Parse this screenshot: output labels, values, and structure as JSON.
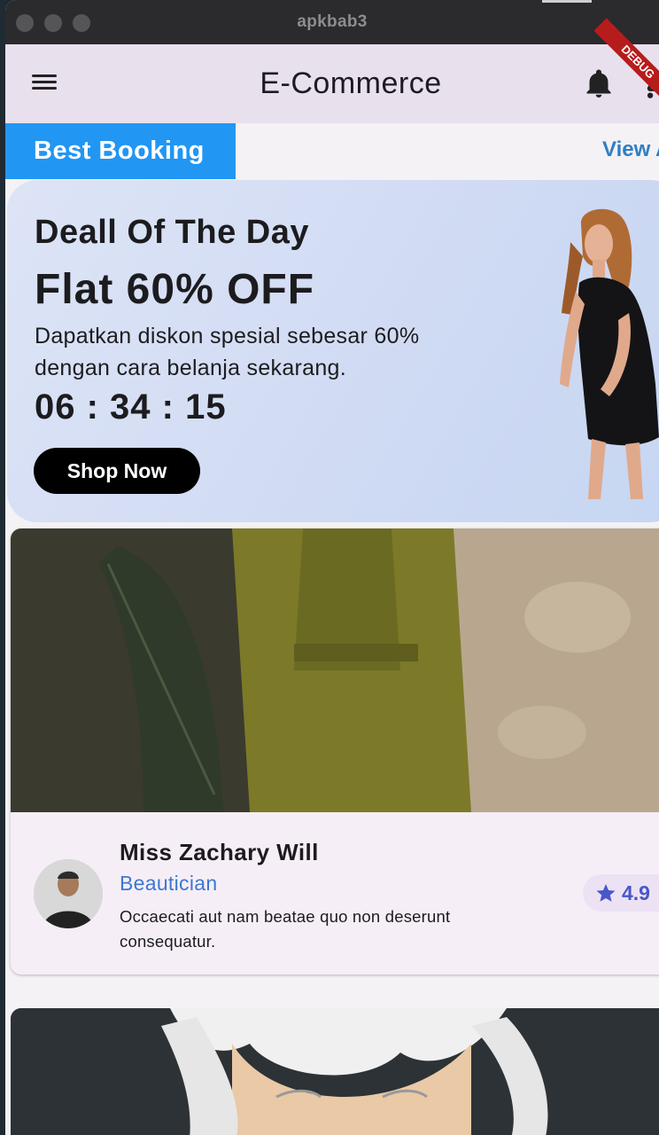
{
  "window": {
    "title": "apkbab3"
  },
  "appbar": {
    "title": "E-Commerce",
    "debug_label": "DEBUG"
  },
  "section": {
    "title": "Best Booking",
    "view_all_label": "View All"
  },
  "deal": {
    "title": "Deall Of The Day",
    "discount": "Flat 60% OFF",
    "description": "Dapatkan diskon spesial sebesar 60% dengan cara belanja sekarang.",
    "timer": "06 : 34 : 15",
    "button_label": "Shop Now"
  },
  "cards": [
    {
      "name": "Miss Zachary Will",
      "role": "Beautician",
      "description": "Occaecati aut nam beatae quo non deserunt consequatur.",
      "rating": "4.9"
    }
  ],
  "colors": {
    "accent": "#2196f3",
    "appbar_bg": "#e9e0ee",
    "role_text": "#3c78d0",
    "rating_text": "#4a57c8"
  },
  "icons": {
    "menu": "menu-icon",
    "bell": "bell-icon",
    "cart": "cart-icon",
    "star": "star-icon"
  }
}
